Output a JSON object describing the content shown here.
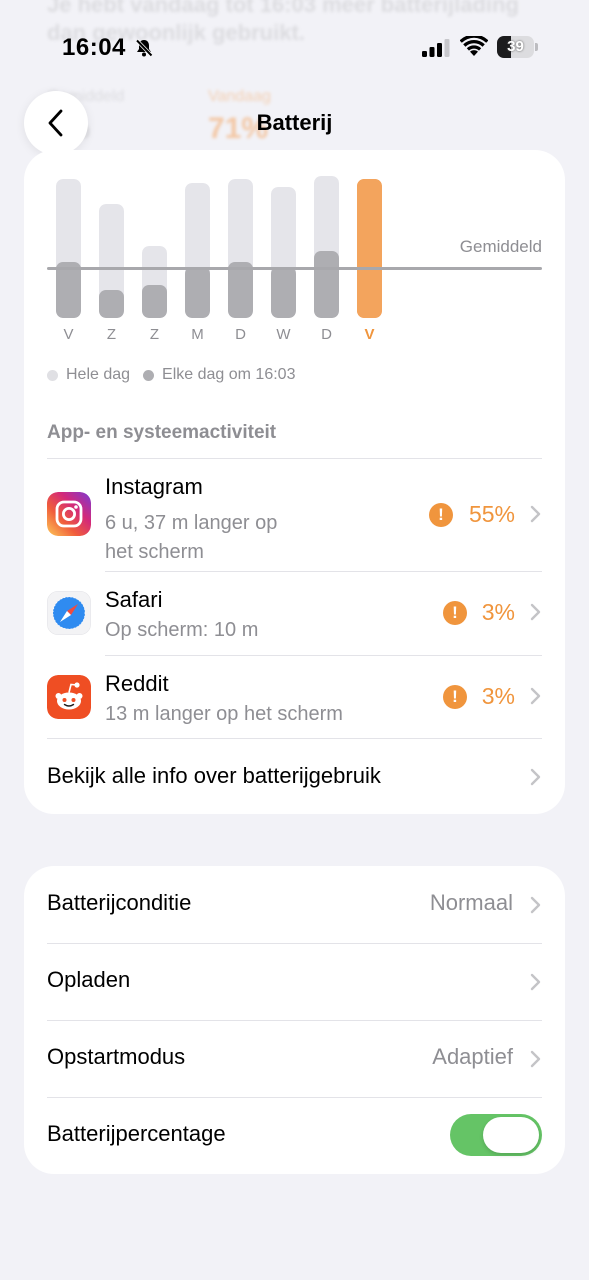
{
  "background_text": {
    "line1": "Je hebt vandaag tot 16:03 meer batterijlading",
    "line2": "dan gewoonlijk gebruikt.",
    "stat1_label": "Gemiddeld",
    "stat1_value": "0%",
    "stat2_label": "Vandaag",
    "stat2_value": "71%"
  },
  "status_bar": {
    "time": "16:04",
    "battery_level": "39",
    "icons": [
      "bell-slash-icon",
      "cellular-signal-icon",
      "wifi-icon",
      "battery-icon"
    ]
  },
  "nav": {
    "title": "Batterij",
    "back_icon": "chevron-left-icon"
  },
  "chart_data": {
    "type": "bar",
    "stacked": true,
    "categories": [
      "V",
      "Z",
      "Z",
      "M",
      "D",
      "W",
      "D",
      "V"
    ],
    "series": [
      {
        "name": "Hele dag",
        "values": [
          100,
          82,
          52,
          97,
          100,
          94,
          102,
          100
        ],
        "color": "#e5e5ea"
      },
      {
        "name": "Elke dag om 16:03",
        "values": [
          40,
          20,
          24,
          37,
          40,
          37,
          48,
          100
        ],
        "color": "#aeaeb2"
      }
    ],
    "highlight_index": 7,
    "highlight_color": "#f3a45d",
    "average_label": "Gemiddeld",
    "average_value": 37,
    "ylim": [
      0,
      105
    ]
  },
  "legend": {
    "items": [
      {
        "label": "Hele dag",
        "color": "#e0e0e4"
      },
      {
        "label": "Elke dag om 16:03",
        "color": "#aeaeb2"
      }
    ]
  },
  "activity": {
    "header": "App- en systeemactiviteit",
    "apps": [
      {
        "name": "Instagram",
        "sub_line1": "6 u, 37 m langer op",
        "sub_line2": "het scherm",
        "percent": "55%",
        "icon": "instagram-icon"
      },
      {
        "name": "Safari",
        "sub_line1": "Op scherm: 10 m",
        "percent": "3%",
        "icon": "safari-icon"
      },
      {
        "name": "Reddit",
        "sub_line1": "13 m langer op het scherm",
        "percent": "3%",
        "icon": "reddit-icon"
      }
    ],
    "all_info_label": "Bekijk alle info over batterijgebruik"
  },
  "settings": {
    "rows": [
      {
        "label": "Batterijconditie",
        "value": "Normaal"
      },
      {
        "label": "Opladen",
        "value": ""
      },
      {
        "label": "Opstartmodus",
        "value": "Adaptief"
      },
      {
        "label": "Batterijpercentage",
        "toggle_on": true
      }
    ]
  },
  "colors": {
    "accent_orange": "#f0953d",
    "toggle_green": "#65c466",
    "secondary_text": "#8e8e93"
  }
}
